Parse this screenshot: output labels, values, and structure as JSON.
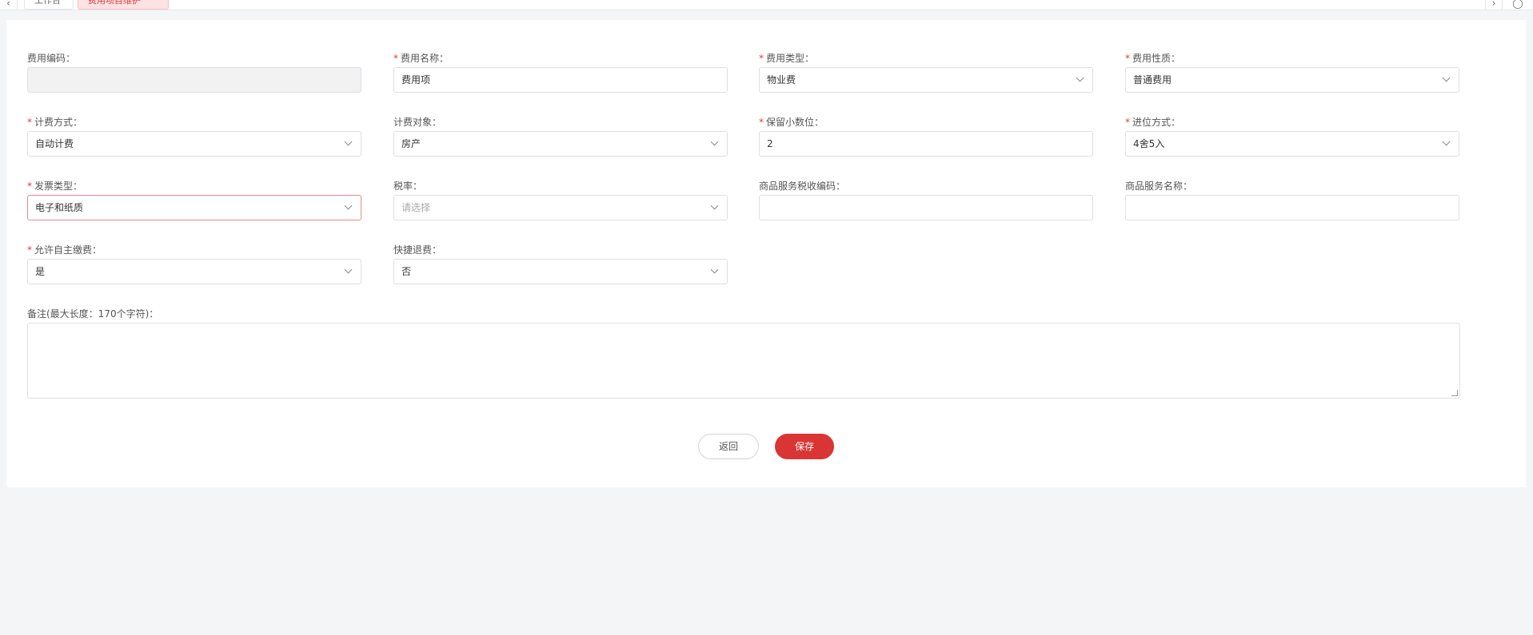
{
  "tabs": {
    "prev_icon": "chevron-left-icon",
    "items": [
      {
        "label": "工作台"
      },
      {
        "label": "费用项目维护"
      }
    ],
    "next_icon": "chevron-right-icon",
    "more_icon": "close-circle-icon"
  },
  "form": {
    "fee_code": {
      "label": "费用编码：",
      "value": "",
      "required": false
    },
    "fee_name": {
      "label": "费用名称：",
      "value": "费用项",
      "required": true
    },
    "fee_type": {
      "label": "费用类型：",
      "value": "物业费",
      "required": true
    },
    "fee_nature": {
      "label": "费用性质：",
      "value": "普通费用",
      "required": true
    },
    "billing_method": {
      "label": "计费方式：",
      "value": "自动计费",
      "required": true
    },
    "billing_object": {
      "label": "计费对象：",
      "value": "房产",
      "required": false
    },
    "decimal_places": {
      "label": "保留小数位：",
      "value": "2",
      "required": true
    },
    "rounding_mode": {
      "label": "进位方式：",
      "value": "4舍5入",
      "required": true
    },
    "invoice_type": {
      "label": "发票类型：",
      "value": "电子和纸质",
      "required": true
    },
    "tax_rate": {
      "label": "税率：",
      "placeholder": "请选择",
      "required": false
    },
    "tax_code": {
      "label": "商品服务税收编码：",
      "value": "",
      "required": false
    },
    "service_name": {
      "label": "商品服务名称：",
      "value": "",
      "required": false
    },
    "self_pay": {
      "label": "允许自主缴费：",
      "value": "是",
      "required": true
    },
    "quick_refund": {
      "label": "快捷退费：",
      "value": "否",
      "required": false
    },
    "remark": {
      "label": "备注(最大长度：170个字符)：",
      "value": ""
    },
    "required_mark": "*"
  },
  "buttons": {
    "back": "返回",
    "save": "保存"
  },
  "colors": {
    "accent": "#d93535",
    "required": "#e4393c",
    "error_border": "#e58a8a",
    "page_bg": "#f4f5f7"
  }
}
